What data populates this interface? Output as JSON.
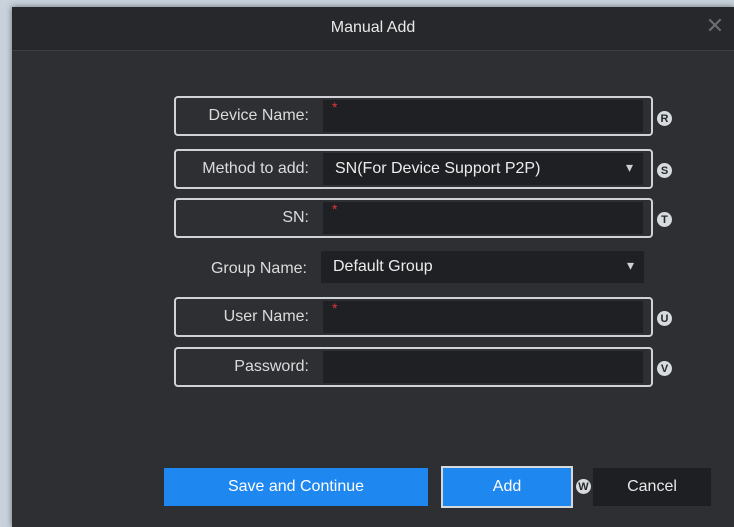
{
  "dialog": {
    "title": "Manual Add",
    "close_glyph": "✕"
  },
  "form": {
    "required_mark": "*",
    "device_name": {
      "label": "Device Name:",
      "value": "",
      "badge": "R"
    },
    "method": {
      "label": "Method to add:",
      "value": "SN(For Device Support P2P)",
      "badge": "S"
    },
    "sn": {
      "label": "SN:",
      "value": "",
      "badge": "T"
    },
    "group": {
      "label": "Group Name:",
      "value": "Default Group"
    },
    "user_name": {
      "label": "User Name:",
      "value": "",
      "badge": "U"
    },
    "password": {
      "label": "Password:",
      "value": "",
      "badge": "V"
    }
  },
  "buttons": {
    "save_continue": "Save and Continue",
    "add": "Add",
    "cancel": "Cancel",
    "cancel_badge": "W"
  },
  "icons": {
    "dropdown_arrow": "▾"
  },
  "colors": {
    "accent": "#1e87f0",
    "dialog_bg": "#2d2f33",
    "field_bg": "#1e2023",
    "required": "#e0363a"
  }
}
